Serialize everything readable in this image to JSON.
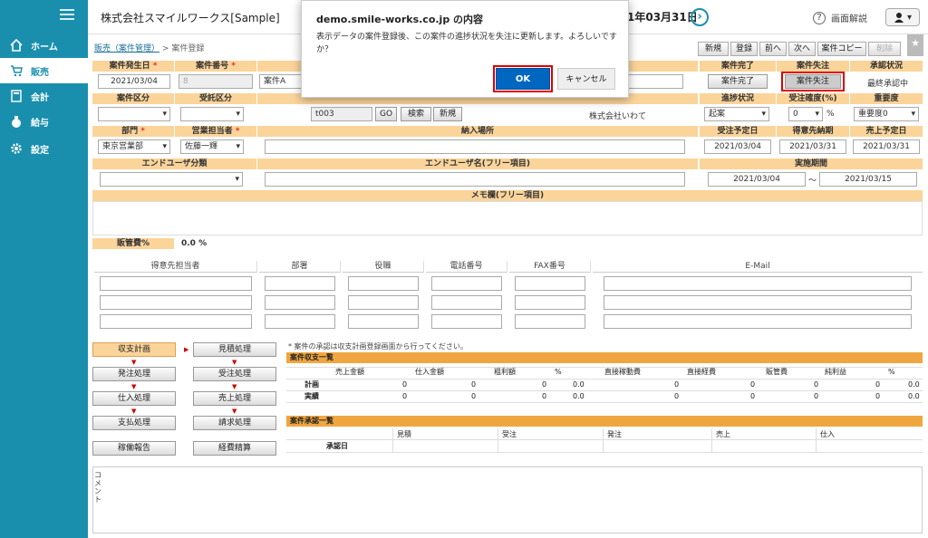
{
  "sidebar": {
    "items": [
      {
        "label": "ホーム",
        "icon": "home-icon"
      },
      {
        "label": "販売",
        "icon": "cart-icon"
      },
      {
        "label": "会計",
        "icon": "calculator-icon"
      },
      {
        "label": "給与",
        "icon": "money-bag-icon"
      },
      {
        "label": "設定",
        "icon": "gear-icon"
      }
    ]
  },
  "topbar": {
    "company": "株式会社スマイルワークス[Sample]",
    "date": "1年03月31日",
    "next": "›",
    "help": "画面解説",
    "user": "▾"
  },
  "breadcrumb": {
    "link": "販売（案件管理）",
    "sep": ">",
    "current": "案件登録"
  },
  "toolbar": {
    "new": "新規",
    "register": "登録",
    "prev": "前へ",
    "next": "次へ",
    "copy": "案件コピー",
    "delete": "削除"
  },
  "row1": {
    "h_date": "案件発生日",
    "h_num": "案件番号",
    "h_done": "案件完了",
    "h_lost": "案件失注",
    "h_appr": "承認状況",
    "date": "2021/03/04",
    "num": "8",
    "name": "案件A",
    "btn_done": "案件完了",
    "btn_lost": "案件失注",
    "appr": "最終承認中",
    "req": "*"
  },
  "row2": {
    "h_kubun": "案件区分",
    "h_itaku": "受託区分",
    "h_status": "進捗状況",
    "h_prob": "受注確度(%)",
    "h_imp": "重要度",
    "code": "t003",
    "go": "GO",
    "search": "検索",
    "new": "新規",
    "customer": "株式会社いわて",
    "status": "起案",
    "prob": "0",
    "pct": "%",
    "imp": "重要度0"
  },
  "row3": {
    "h_dept": "部門",
    "h_rep": "営業担当者",
    "h_place": "納入場所",
    "h_order": "受注予定日",
    "h_deliv": "得意先納期",
    "h_sales": "売上予定日",
    "dept": "東京営業部",
    "rep": "佐藤一輝",
    "order": "2021/03/04",
    "deliv": "2021/03/31",
    "sales": "2021/03/31"
  },
  "row4": {
    "h_eu": "エンドユーザ分類",
    "h_euname": "エンドユーザ名(フリー項目)",
    "h_period": "実施期間",
    "from": "2021/03/04",
    "tilde": "～",
    "to": "2021/03/15"
  },
  "memo": {
    "label": "メモ欄(フリー項目)"
  },
  "sga": {
    "label": "販管費%",
    "value": "0.0 %"
  },
  "contacts": {
    "headers": [
      "得意先担当者",
      "部署",
      "役職",
      "電話番号",
      "FAX番号",
      "E-Mail"
    ]
  },
  "process": {
    "note": "* 案件の承認は収支計画登録画面から行ってください。",
    "buttons": [
      "収支計画",
      "見積処理",
      "発注処理",
      "受注処理",
      "仕入処理",
      "売上処理",
      "支払処理",
      "請求処理",
      "稼働報告",
      "経費精算"
    ]
  },
  "pl": {
    "title": "案件収支一覧",
    "headers": [
      "売上金額",
      "仕入金額",
      "粗利額",
      "%",
      "直接稼動費",
      "直接経費",
      "販管費",
      "純利益",
      "%"
    ],
    "rows": [
      {
        "label": "計画",
        "values": [
          "0",
          "0",
          "0",
          "0.0",
          "0",
          "0",
          "0",
          "0",
          "0.0"
        ]
      },
      {
        "label": "実績",
        "values": [
          "0",
          "0",
          "0",
          "0.0",
          "0",
          "0",
          "0",
          "0",
          "0.0"
        ]
      }
    ]
  },
  "approval": {
    "title": "案件承認一覧",
    "headers": [
      "見積",
      "受注",
      "発注",
      "売上",
      "仕入"
    ],
    "row_label": "承認日"
  },
  "comment": {
    "label": "コメント"
  },
  "dialog": {
    "title": "demo.smile-works.co.jp の内容",
    "message": "表示データの案件登録後、この案件の進捗状況を失注に更新します。よろしいですか？",
    "ok": "OK",
    "cancel": "キャンセル"
  }
}
